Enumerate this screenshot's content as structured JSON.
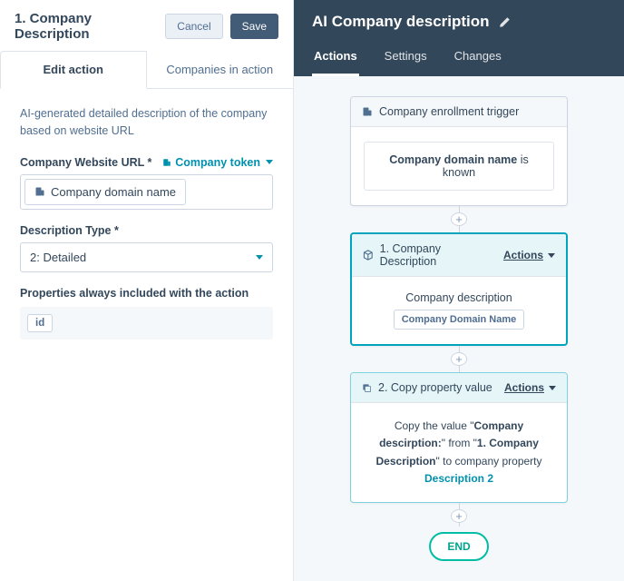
{
  "left": {
    "title": "1. Company Description",
    "cancel": "Cancel",
    "save": "Save",
    "tabs": {
      "edit": "Edit action",
      "companies": "Companies in action"
    },
    "intro": "AI-generated detailed description of the company based on website URL",
    "urlField": {
      "label": "Company Website URL *",
      "tokenLink": "Company token",
      "chip": "Company domain name"
    },
    "typeField": {
      "label": "Description Type *",
      "value": "2: Detailed"
    },
    "propsField": {
      "label": "Properties always included with the action",
      "chip": "id"
    }
  },
  "right": {
    "title": "AI Company description",
    "tabs": {
      "actions": "Actions",
      "settings": "Settings",
      "changes": "Changes"
    },
    "trigger": {
      "title": "Company enrollment trigger",
      "boldText": "Company domain name",
      "suffix": " is known"
    },
    "step1": {
      "title": "1. Company Description",
      "actions": "Actions",
      "desc": "Company description",
      "chip": "Company Domain Name"
    },
    "step2": {
      "title": "2. Copy property value",
      "actions": "Actions",
      "text1": "Copy the value \"",
      "bold1": "Company descirption:",
      "text2": "\" from \"",
      "bold2": "1. Company Description",
      "text3": "\" to company property ",
      "link": "Description 2"
    },
    "end": "END"
  }
}
